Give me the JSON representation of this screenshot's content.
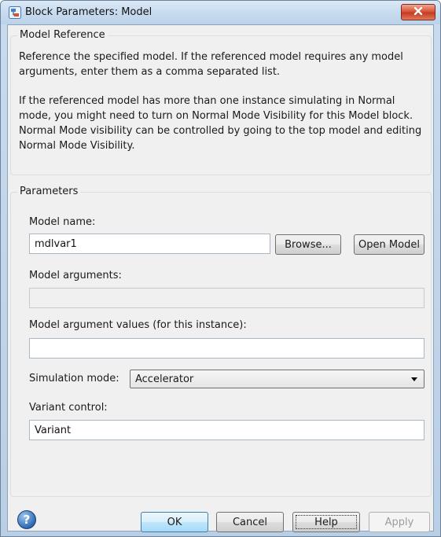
{
  "window": {
    "title": "Block Parameters: Model"
  },
  "model_reference": {
    "group_label": "Model Reference",
    "description_1": "Reference the specified model. If the referenced model requires any model arguments, enter them as a comma separated list.",
    "description_2": "If the referenced model has more than one instance simulating in Normal mode, you might need to turn on Normal Mode Visibility for this Model block. Normal Mode visibility can be controlled by going to the top model and editing Normal Mode Visibility."
  },
  "parameters": {
    "group_label": "Parameters",
    "model_name_label": "Model name:",
    "model_name_value": "mdlvar1",
    "browse_label": "Browse...",
    "open_model_label": "Open Model",
    "model_arguments_label": "Model arguments:",
    "model_arguments_value": "",
    "model_argument_values_label": "Model argument values (for this instance):",
    "model_argument_values_value": "",
    "simulation_mode_label": "Simulation mode:",
    "simulation_mode_value": "Accelerator",
    "variant_control_label": "Variant control:",
    "variant_control_value": "Variant"
  },
  "footer": {
    "ok_label": "OK",
    "cancel_label": "Cancel",
    "help_label": "Help",
    "apply_label": "Apply"
  },
  "icons": {
    "help": "help-circle-icon",
    "close": "close-icon",
    "app": "simulink-block-icon",
    "dropdown": "chevron-down-icon"
  }
}
